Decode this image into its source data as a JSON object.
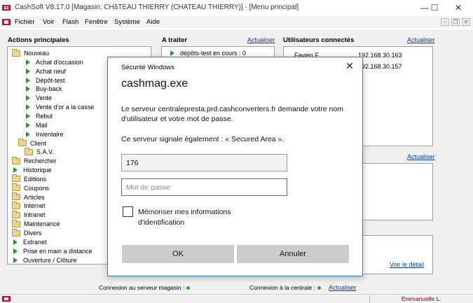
{
  "window": {
    "title": "CashSoft V8.17.0 [Magasin: CHâTEAU THIERRY (CHATEAU THIERRY)] - [Menu principal]",
    "minimize": "—",
    "maximize": "☐",
    "close": "✕"
  },
  "menu": {
    "items": [
      "Fichier",
      "Voir",
      "Flash",
      "Fenêtre",
      "Système",
      "Aide"
    ],
    "mdi_minimize": "–",
    "mdi_restore": "❐",
    "mdi_close": "✕"
  },
  "actions": {
    "title": "Actions principales",
    "tree": [
      {
        "label": "Nouveau",
        "icon": "folder"
      },
      {
        "label": "Achat d'occasion",
        "icon": "arrow"
      },
      {
        "label": "Achat neuf",
        "icon": "arrow"
      },
      {
        "label": "Dépôt-test",
        "icon": "arrow"
      },
      {
        "label": "Buy-back",
        "icon": "arrow"
      },
      {
        "label": "Vente",
        "icon": "arrow"
      },
      {
        "label": "Vente d'or a la casse",
        "icon": "arrow"
      },
      {
        "label": "Rebut",
        "icon": "arrow"
      },
      {
        "label": "Mail",
        "icon": "arrow"
      },
      {
        "label": "Inventaire",
        "icon": "arrow"
      },
      {
        "label": "Client",
        "icon": "folder"
      },
      {
        "label": "S.A.V.",
        "icon": "folder"
      },
      {
        "label": "Rechercher",
        "icon": "folder"
      },
      {
        "label": "Historique",
        "icon": "arrow"
      },
      {
        "label": "Editions",
        "icon": "folder"
      },
      {
        "label": "Coupons",
        "icon": "folder"
      },
      {
        "label": "Articles",
        "icon": "folder"
      },
      {
        "label": "Internet",
        "icon": "folder"
      },
      {
        "label": "Intranet",
        "icon": "folder"
      },
      {
        "label": "Maintenance",
        "icon": "folder"
      },
      {
        "label": "Divers",
        "icon": "folder"
      },
      {
        "label": "Extranet",
        "icon": "arrow"
      },
      {
        "label": "Prise en main a distance",
        "icon": "arrow"
      },
      {
        "label": "Ouverture / Clôture",
        "icon": "arrow"
      }
    ]
  },
  "todo": {
    "title": "A traiter",
    "refresh": "Actualiser",
    "items": [
      "dépôts-test en cours : 0"
    ]
  },
  "users": {
    "title": "Utilisateurs connectés",
    "refresh": "Actualiser",
    "rows": [
      {
        "name": "Favien F.",
        "ip": "192.168.30.163"
      },
      {
        "name": "",
        "ip": "192.168.30.157"
      }
    ]
  },
  "right_panel2": {
    "refresh": "Actualiser"
  },
  "right_panel3": {
    "detail_link": "Voir le détail"
  },
  "status": {
    "store_connection": "Connexion au serveur magasin :",
    "central_connection": "Connexion à la centrale :",
    "refresh": "Actualiser",
    "user": "Emmanuelle L.",
    "ok_color": "#22b022"
  },
  "dialog": {
    "title": "Sécurité Windows",
    "close": "✕",
    "app": "cashmag.exe",
    "message": "Le serveur centralepresta.prd.cashconverters.fr demande votre nom d'utilisateur et votre mot de passe.",
    "message2": "Ce serveur signale également : « Secured Area ».",
    "username_value": "176",
    "password_placeholder": "Mot de passe",
    "remember_label": "Mémoriser mes informations d'identification",
    "remember_checked": false,
    "ok": "OK",
    "cancel": "Annuler",
    "accent": "#1f78d1"
  }
}
